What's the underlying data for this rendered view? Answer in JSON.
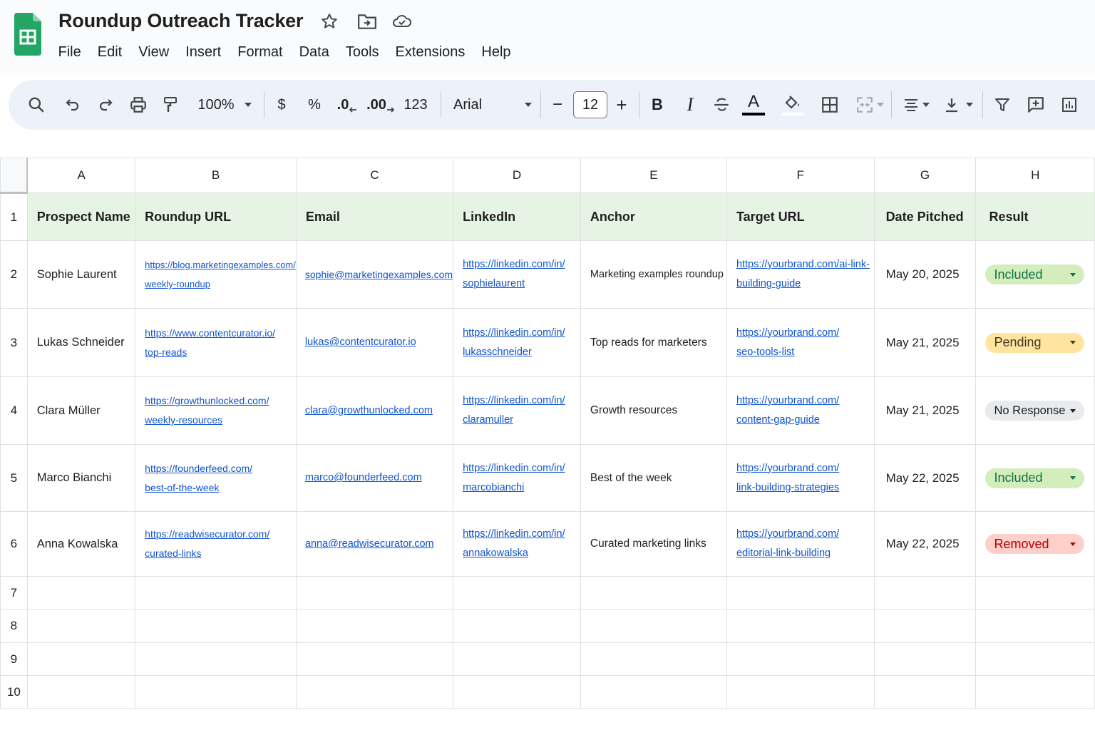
{
  "document": {
    "title": "Roundup Outreach Tracker"
  },
  "title_icons": [
    "star-icon",
    "move-folder-icon",
    "cloud-saved-icon"
  ],
  "menu": [
    "File",
    "Edit",
    "View",
    "Insert",
    "Format",
    "Data",
    "Tools",
    "Extensions",
    "Help"
  ],
  "toolbar": {
    "zoom": "100%",
    "currency": "$",
    "percent": "%",
    "decrease_decimal": ".0",
    "increase_decimal": ".00",
    "number_format": "123",
    "font": "Arial",
    "font_size": "12",
    "minus": "−",
    "plus": "+",
    "bold": "B",
    "italic": "I",
    "text_color_letter": "A"
  },
  "columns": [
    "A",
    "B",
    "C",
    "D",
    "E",
    "F",
    "G",
    "H"
  ],
  "row_numbers": [
    "1",
    "2",
    "3",
    "4",
    "5",
    "6",
    "7",
    "8",
    "9",
    "10"
  ],
  "header_row": [
    "Prospect Name",
    "Roundup URL",
    "Email",
    "LinkedIn",
    "Anchor",
    "Target URL",
    "Date Pitched",
    "Result"
  ],
  "rows": [
    {
      "name": "Sophie Laurent",
      "roundup_url": [
        "https://blog.marketingexamples.com/",
        "weekly-roundup"
      ],
      "email": "sophie@marketingexamples.com",
      "linkedin": [
        "https://linkedin.com/in/",
        "sophielaurent"
      ],
      "anchor": "Marketing examples roundup",
      "target_url": [
        "https://yourbrand.com/ai-link-",
        "building-guide"
      ],
      "date": "May 20, 2025",
      "result": "Included"
    },
    {
      "name": "Lukas Schneider",
      "roundup_url": [
        "https://www.contentcurator.io/",
        "top-reads"
      ],
      "email": "lukas@contentcurator.io",
      "linkedin": [
        "https://linkedin.com/in/",
        "lukasschneider"
      ],
      "anchor": "Top reads for marketers",
      "target_url": [
        "https://yourbrand.com/",
        "seo-tools-list"
      ],
      "date": "May 21, 2025",
      "result": "Pending"
    },
    {
      "name": "Clara Müller",
      "roundup_url": [
        "https://growthunlocked.com/",
        "weekly-resources"
      ],
      "email": "clara@growthunlocked.com",
      "linkedin": [
        "https://linkedin.com/in/",
        "claramuller"
      ],
      "anchor": "Growth resources",
      "target_url": [
        "https://yourbrand.com/",
        "content-gap-guide"
      ],
      "date": "May 21, 2025",
      "result": "No Response"
    },
    {
      "name": "Marco Bianchi",
      "roundup_url": [
        "https://founderfeed.com/",
        "best-of-the-week"
      ],
      "email": "marco@founderfeed.com",
      "linkedin": [
        "https://linkedin.com/in/",
        "marcobianchi"
      ],
      "anchor": "Best of the week",
      "target_url": [
        "https://yourbrand.com/",
        "link-building-strategies"
      ],
      "date": "May 22, 2025",
      "result": "Included"
    },
    {
      "name": "Anna Kowalska",
      "roundup_url": [
        "https://readwisecurator.com/",
        "curated-links"
      ],
      "email": "anna@readwisecurator.com",
      "linkedin": [
        "https://linkedin.com/in/",
        "annakowalska"
      ],
      "anchor": "Curated marketing links",
      "target_url": [
        "https://yourbrand.com/",
        "editorial-link-building"
      ],
      "date": "May 22, 2025",
      "result": "Removed"
    }
  ],
  "colors": {
    "header_fill": "#e6f4e3",
    "link": "#1155cc",
    "included_bg": "#d4edbc",
    "pending_bg": "#ffe5a0",
    "no_response_bg": "#e8eaed",
    "removed_bg": "#ffcfc9"
  }
}
